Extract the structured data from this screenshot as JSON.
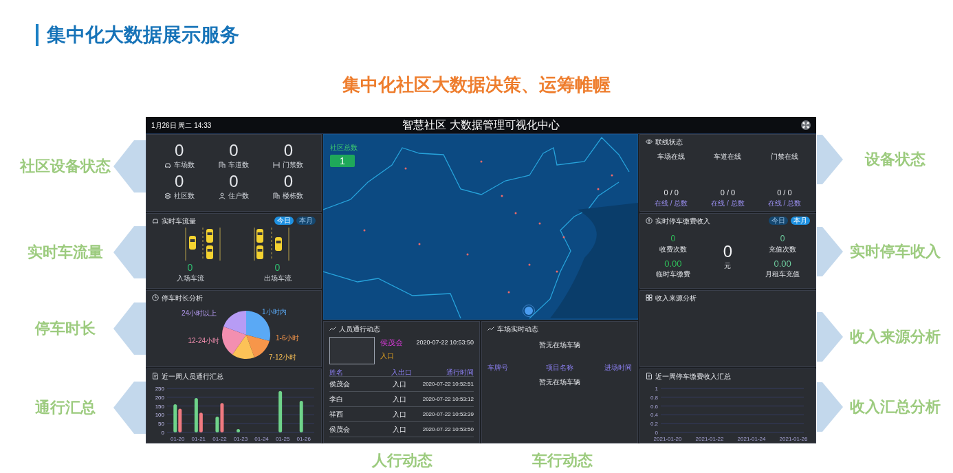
{
  "slide": {
    "title": "集中化大数据展示服务",
    "subtitle": "集中化社区大数据决策、运筹帷幄"
  },
  "dashboard": {
    "datetime": "1月26日 周二 14:33",
    "title": "智慧社区 大数据管理可视化中心",
    "device_counts": [
      {
        "value": "0",
        "label": "车场数",
        "kind": "car"
      },
      {
        "value": "0",
        "label": "车道数",
        "kind": "building"
      },
      {
        "value": "0",
        "label": "门禁数",
        "kind": "gate"
      },
      {
        "value": "0",
        "label": "社区数",
        "kind": "layers"
      },
      {
        "value": "0",
        "label": "住户数",
        "kind": "person"
      },
      {
        "value": "0",
        "label": "楼栋数",
        "kind": "building"
      }
    ],
    "traffic": {
      "title": "实时车流量",
      "tabs": [
        {
          "label": "今日",
          "selected": true
        },
        {
          "label": "本月",
          "selected": false
        }
      ],
      "flows": [
        {
          "value": "0",
          "label": "入场车流"
        },
        {
          "value": "0",
          "label": "出场车流"
        }
      ]
    },
    "duration": {
      "title": "停车时长分析",
      "slices": [
        {
          "label": "1小时内",
          "color": "#5aa9f5"
        },
        {
          "label": "1-6小时",
          "color": "#f7964a"
        },
        {
          "label": "7-12小时",
          "color": "#fcc257"
        },
        {
          "label": "12-24小时",
          "color": "#f38fb0"
        },
        {
          "label": "24小时以上",
          "color": "#b79cf5"
        }
      ]
    },
    "pass_summary": {
      "title": "近一周人员通行汇总",
      "chart_data": {
        "type": "bar",
        "categories": [
          "01-20",
          "01-21",
          "01-22",
          "01-23",
          "01-24",
          "01-25",
          "01-26"
        ],
        "series": [
          {
            "color": "#6fd38a",
            "values": [
              160,
              195,
              90,
              20,
              0,
              235,
              180
            ]
          },
          {
            "color": "#f07a80",
            "values": [
              135,
              112,
              167,
              null,
              null,
              null,
              null
            ]
          }
        ],
        "ylim": [
          0,
          250
        ],
        "yticks": [
          0,
          50,
          100,
          150,
          200,
          250
        ],
        "grid": true
      }
    },
    "map": {
      "label": "社区总数",
      "value": "1"
    },
    "people": {
      "title": "人员通行动态",
      "latest": {
        "name": "侯茂会",
        "gate": "入口",
        "time": "2020-07-22 10:53:50"
      },
      "columns": [
        "姓名",
        "入出口",
        "通行时间"
      ],
      "rows": [
        [
          "侯茂会",
          "入口",
          "2020-07-22 10:52:51"
        ],
        [
          "李白",
          "入口",
          "2020-07-22 10:53:12"
        ],
        [
          "祥西",
          "入口",
          "2020-07-22 10:53:39"
        ],
        [
          "侯茂会",
          "入口",
          "2020-07-22 10:53:50"
        ]
      ]
    },
    "vehicles": {
      "title": "车场实时动态",
      "empty_text": "暂无在场车辆",
      "columns": [
        "车牌号",
        "项目名称",
        "进场时间"
      ],
      "table_empty_text": "暂无在场车辆"
    },
    "online": {
      "title": "联线状态",
      "items": [
        {
          "label": "车场在线",
          "value": "0 / 0",
          "caption": "在线 / 总数"
        },
        {
          "label": "车道在线",
          "value": "0 / 0",
          "caption": "在线 / 总数"
        },
        {
          "label": "门禁在线",
          "value": "0 / 0",
          "caption": "在线 / 总数"
        }
      ]
    },
    "income": {
      "title": "实时停车缴费收入",
      "tabs": [
        {
          "label": "今日",
          "selected": false
        },
        {
          "label": "本月",
          "selected": true
        }
      ],
      "stats": [
        {
          "value": "0",
          "label": "收费次数"
        },
        {
          "value": "0.00",
          "label": "临时车缴费"
        },
        {
          "value": "0",
          "label": "充值次数"
        },
        {
          "value": "0.00",
          "label": "月租车充值"
        }
      ],
      "total": {
        "value": "0",
        "unit": "元"
      }
    },
    "income_source": {
      "title": "收入来源分析"
    },
    "income_summary": {
      "title": "近一周停车缴费收入汇总",
      "chart_data": {
        "type": "line",
        "categories": [
          "2021-01-20",
          "2021-01-22",
          "2021-01-24",
          "2021-01-26"
        ],
        "ylim": [
          0,
          1
        ],
        "yticks": [
          0,
          0.2,
          0.4,
          0.6,
          0.8,
          1
        ],
        "grid": true
      }
    }
  },
  "callouts": [
    {
      "label": "社区设备状态",
      "kind": "left"
    },
    {
      "label": "实时车流量",
      "kind": "left"
    },
    {
      "label": "停车时长",
      "kind": "left"
    },
    {
      "label": "通行汇总",
      "kind": "left"
    },
    {
      "label": "设备状态",
      "kind": "right"
    },
    {
      "label": "实时停车收入",
      "kind": "right"
    },
    {
      "label": "收入来源分析",
      "kind": "right"
    },
    {
      "label": "收入汇总分析",
      "kind": "right"
    },
    {
      "label": "人行动态",
      "kind": "bottom"
    },
    {
      "label": "车行动态",
      "kind": "bottom"
    }
  ]
}
